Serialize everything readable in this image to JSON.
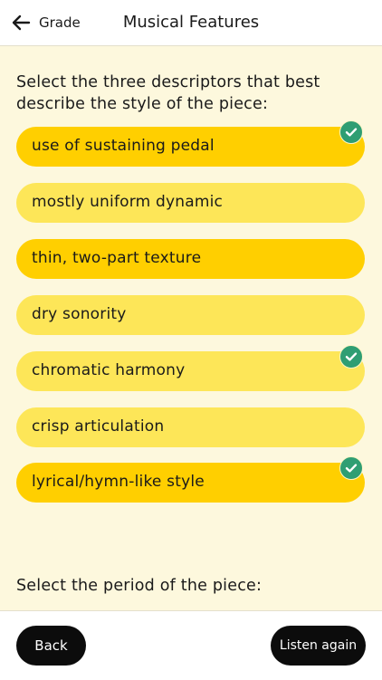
{
  "header": {
    "back_label": "Grade",
    "title": "Musical Features"
  },
  "main": {
    "question1": "Select the three descriptors that best describe the style of the piece:",
    "options": [
      {
        "label": "use of sustaining pedal",
        "selected": true,
        "checked": true
      },
      {
        "label": "mostly uniform dynamic",
        "selected": false,
        "checked": false
      },
      {
        "label": "thin, two-part texture",
        "selected": true,
        "checked": false
      },
      {
        "label": "dry sonority",
        "selected": false,
        "checked": false
      },
      {
        "label": "chromatic harmony",
        "selected": false,
        "checked": true
      },
      {
        "label": "crisp articulation",
        "selected": false,
        "checked": false
      },
      {
        "label": "lyrical/hymn-like style",
        "selected": true,
        "checked": true
      }
    ],
    "question2": "Select the period of the piece:"
  },
  "footer": {
    "back_label": "Back",
    "listen_label": "Listen again"
  },
  "colors": {
    "background": "#fdf8dd",
    "option_selected": "#ffcf00",
    "option_default": "#fde658",
    "check": "#2f9e73",
    "button": "#0c0c0c"
  }
}
